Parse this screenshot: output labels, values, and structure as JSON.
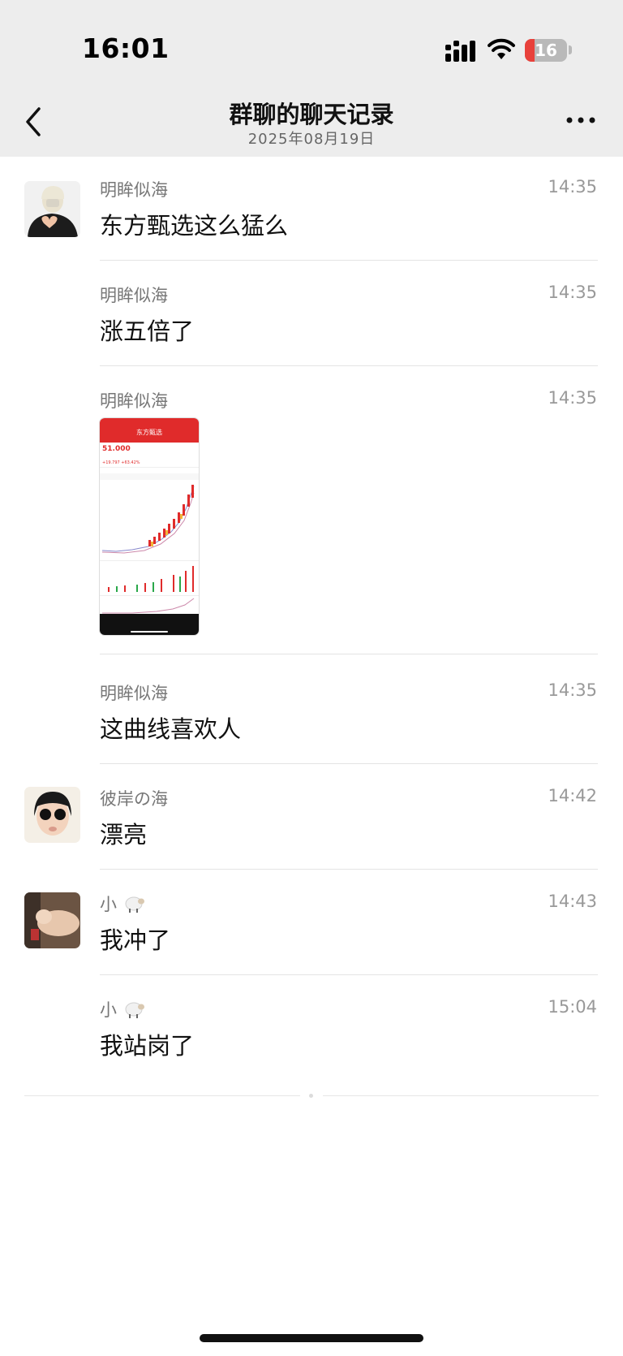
{
  "status_bar": {
    "time": "16:01",
    "battery": "16"
  },
  "nav": {
    "title": "群聊的聊天记录",
    "subtitle": "2025年08月19日"
  },
  "messages": [
    {
      "sender": "明眸似海",
      "time": "14:35",
      "text": "东方甄选这么猛么"
    },
    {
      "sender": "明眸似海",
      "time": "14:35",
      "text": "涨五倍了"
    },
    {
      "sender": "明眸似海",
      "time": "14:35",
      "text": ""
    },
    {
      "sender": "明眸似海",
      "time": "14:35",
      "text": "这曲线喜欢人"
    },
    {
      "sender": "彼岸の海",
      "time": "14:42",
      "text": "漂亮"
    },
    {
      "sender": "小",
      "time": "14:43",
      "text": "我冲了"
    },
    {
      "sender": "小",
      "time": "15:04",
      "text": "我站岗了"
    }
  ],
  "screenshot": {
    "app_title": "东方甄选",
    "price": "51.000",
    "lines": [
      "+19.797 +63.42%"
    ]
  },
  "colors": {
    "header_bg": "#ededed",
    "accent_red": "#e8413b",
    "chart_red": "#e02b2b"
  },
  "icons": [
    "back-chevron-icon",
    "more-dots-icon",
    "signal-icon",
    "wifi-icon",
    "sheep-emoji-icon"
  ]
}
